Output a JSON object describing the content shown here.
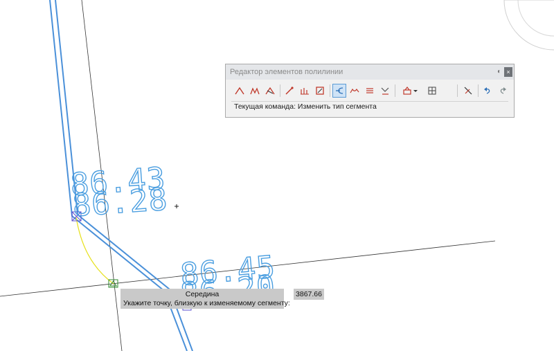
{
  "drawing": {
    "dimension_labels": [
      "86.43",
      "86.28",
      "86.45",
      "86.20"
    ]
  },
  "polyline_editor": {
    "title": "Редактор элементов полилинии",
    "close_glyph": "×",
    "pin_glyph": "◐",
    "tools": [
      {
        "icon": "insert-pi-icon",
        "color": "#c0392b"
      },
      {
        "icon": "insert-multiple-pi-icon",
        "color": "#c0392b"
      },
      {
        "icon": "delete-pi-icon",
        "color": "#c0392b"
      },
      {
        "icon": "move-pi-icon",
        "color": "#c0392b"
      },
      {
        "icon": "elevation-editor-icon",
        "color": "#c0392b"
      },
      {
        "icon": "edit-vertex-icon",
        "color": "#c0392b"
      },
      {
        "icon": "change-segment-type-icon",
        "color": "#2c6fb7",
        "active": true
      },
      {
        "icon": "fillet-icon",
        "color": "#c0392b"
      },
      {
        "icon": "offset-icon",
        "color": "#c0392b"
      },
      {
        "icon": "break-icon",
        "color": "#c0392b"
      },
      {
        "icon": "properties-icon",
        "color": "#c0392b"
      },
      {
        "icon": "dropdown-arrow-icon",
        "color": "#333333"
      },
      {
        "icon": "grid-view-icon",
        "color": "#333333"
      },
      {
        "icon": "exit-editor-icon",
        "color": "#333333"
      },
      {
        "icon": "undo-icon",
        "color": "#2c6fb7"
      },
      {
        "icon": "redo-icon",
        "color": "#7f8c8d"
      }
    ],
    "status": "Текущая команда: Изменить тип сегмента"
  },
  "tooltip": {
    "snap_name": "Середина",
    "prompt": "Укажите точку, близкую к изменяемому сегменту:"
  },
  "coordinate_readout": "3867.66",
  "colors": {
    "polyline": "#4a90d9",
    "dimension_text": "#4a9ee0",
    "construction_line": "#333333",
    "rubber_band": "#e6e01a",
    "snap_marker": "#2e8b2e",
    "vertex_marker": "#5a4fcf"
  }
}
